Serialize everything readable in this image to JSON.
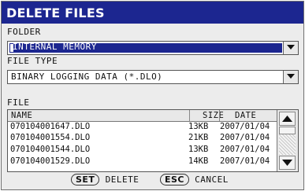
{
  "dialog": {
    "title": "DELETE FILES"
  },
  "folder": {
    "label": "FOLDER",
    "value": "INTERNAL MEMORY"
  },
  "file_type": {
    "label": "FILE TYPE",
    "value": "BINARY LOGGING DATA (*.DLO)"
  },
  "file_list": {
    "label": "FILE",
    "columns": {
      "name": "NAME",
      "size": "SIZE",
      "date": "DATE"
    },
    "rows": [
      {
        "name": "070104001647.DLO",
        "size": "13KB",
        "date": "2007/01/04"
      },
      {
        "name": "070104001554.DLO",
        "size": "21KB",
        "date": "2007/01/04"
      },
      {
        "name": "070104001544.DLO",
        "size": "13KB",
        "date": "2007/01/04"
      },
      {
        "name": "070104001529.DLO",
        "size": "14KB",
        "date": "2007/01/04"
      }
    ]
  },
  "footer": {
    "set_key": "SET",
    "set_label": "DELETE",
    "esc_key": "ESC",
    "esc_label": "CANCEL"
  }
}
